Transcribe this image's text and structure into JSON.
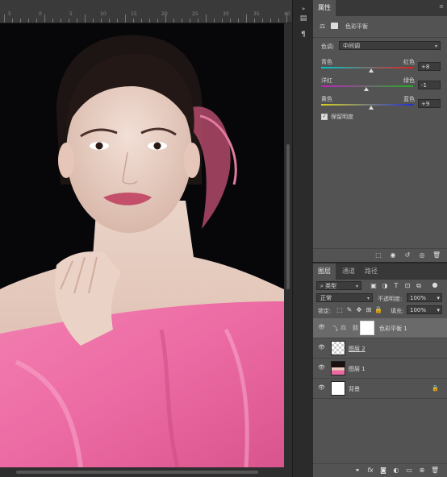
{
  "ruler": {
    "labels": [
      "5",
      "0",
      "5",
      "10",
      "15",
      "20",
      "25",
      "30",
      "35",
      "40"
    ]
  },
  "properties_panel": {
    "tab": "属性",
    "adjustment_name": "色彩平衡",
    "tone_label": "色调:",
    "tone_value": "中间调",
    "sliders": [
      {
        "left": "青色",
        "right": "红色",
        "value": "+8",
        "position": 0.54,
        "colors": [
          "#00c8c8",
          "#e02020"
        ]
      },
      {
        "left": "洋红",
        "right": "绿色",
        "value": "-1",
        "position": 0.49,
        "colors": [
          "#c020c0",
          "#20b020"
        ]
      },
      {
        "left": "黄色",
        "right": "蓝色",
        "value": "+9",
        "position": 0.545,
        "colors": [
          "#d8d020",
          "#2030d0"
        ]
      }
    ],
    "preserve_luminosity": "保留明度",
    "preserve_checked": true
  },
  "layers_panel": {
    "tabs": [
      "图层",
      "通道",
      "路径"
    ],
    "filter_label": "类型",
    "blend_mode": "正常",
    "opacity_label": "不透明度:",
    "opacity_value": "100%",
    "lock_label": "锁定:",
    "fill_label": "填充:",
    "fill_value": "100%",
    "layers": [
      {
        "name": "色彩平衡 1",
        "type": "adjustment",
        "selected": true
      },
      {
        "name": "图层 2",
        "type": "transparent",
        "selected": false
      },
      {
        "name": "图层 1",
        "type": "photo",
        "selected": false
      },
      {
        "name": "背景",
        "type": "background",
        "selected": false,
        "locked": true
      }
    ],
    "footer_icons": [
      "link-icon",
      "fx-icon",
      "mask-icon",
      "adjustment-icon",
      "folder-icon",
      "new-layer-icon",
      "trash-icon"
    ]
  },
  "colors": {
    "panel": "#535353",
    "dark": "#282828",
    "selected_layer": "#6a6a6a"
  }
}
